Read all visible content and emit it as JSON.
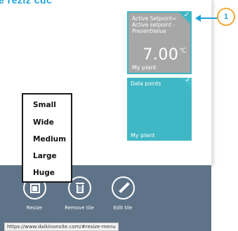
{
  "top_fragment": "e reziz cdc",
  "tiles": [
    {
      "caption": "Active Setpoint= Active setpoint - PresentValue",
      "value": "7.00",
      "unit": "℃",
      "footer": "My plant",
      "check": "✓"
    },
    {
      "caption": "Data points",
      "footer": "My plant",
      "check": "✓"
    }
  ],
  "callout": {
    "number": "1"
  },
  "resize_menu": {
    "items": [
      "Small",
      "Wide",
      "Medium",
      "Large",
      "Huge"
    ]
  },
  "appbar": {
    "items": [
      {
        "label": "Resize",
        "icon": "resize-icon"
      },
      {
        "label": "Remove tile",
        "icon": "trash-icon"
      },
      {
        "label": "Edit tile",
        "icon": "pencil-icon"
      }
    ]
  },
  "status_url": "https://www.daikinonsite.com/#resize-menu",
  "colors": {
    "tile_gray": "#a7a7a7",
    "tile_teal": "#3fb7c4",
    "appbar": "#5f7388",
    "callout_blue": "#1aa3d9",
    "callout_ring": "#f1a93a"
  }
}
